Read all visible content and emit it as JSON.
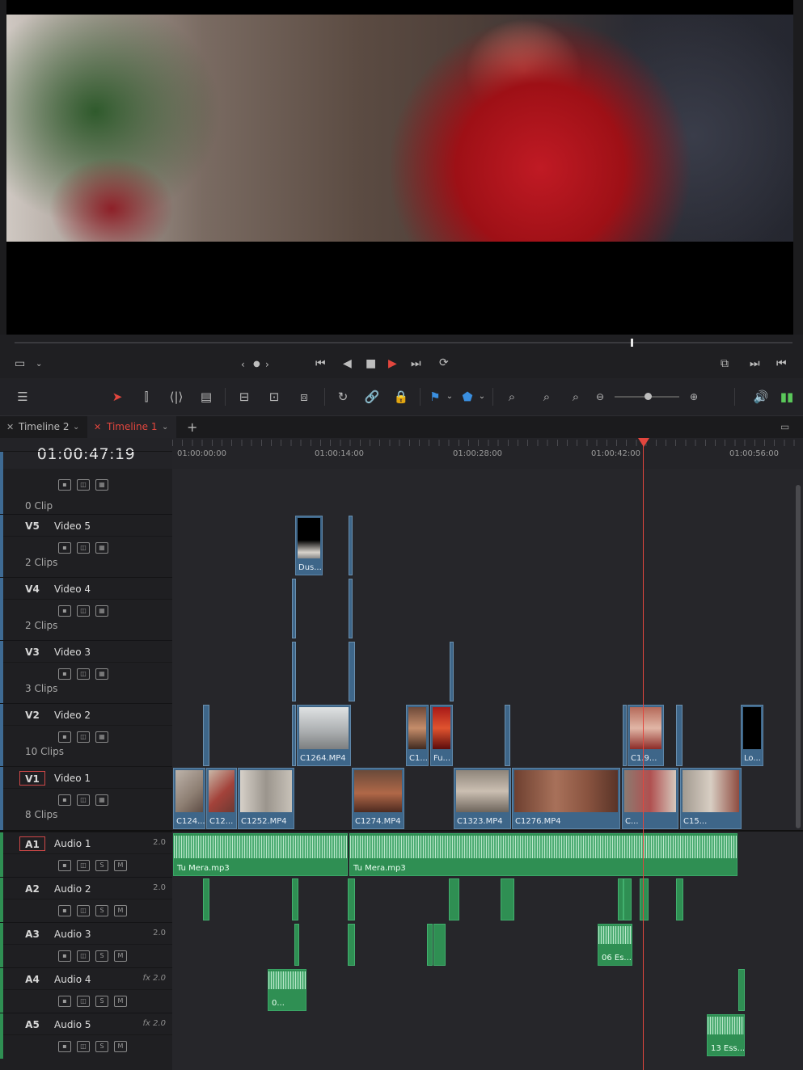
{
  "timecode": "01:00:47:19",
  "tabs": [
    {
      "label": "Timeline 2",
      "active": false
    },
    {
      "label": "Timeline 1",
      "active": true
    }
  ],
  "ruler": [
    "01:00:00:00",
    "01:00:14:00",
    "01:00:28:00",
    "01:00:42:00",
    "01:00:56:00"
  ],
  "video_tracks": [
    {
      "id": "",
      "name": "",
      "count": "0 Clip"
    },
    {
      "id": "V5",
      "name": "Video 5",
      "count": "2 Clips"
    },
    {
      "id": "V4",
      "name": "Video 4",
      "count": "2 Clips"
    },
    {
      "id": "V3",
      "name": "Video 3",
      "count": "3 Clips"
    },
    {
      "id": "V2",
      "name": "Video 2",
      "count": "10 Clips"
    },
    {
      "id": "V1",
      "name": "Video 1",
      "count": "8 Clips"
    }
  ],
  "audio_tracks": [
    {
      "id": "A1",
      "name": "Audio 1",
      "channels": "2.0"
    },
    {
      "id": "A2",
      "name": "Audio 2",
      "channels": "2.0"
    },
    {
      "id": "A3",
      "name": "Audio 3",
      "channels": "2.0"
    },
    {
      "id": "A4",
      "name": "Audio 4",
      "channels": "fx 2.0"
    },
    {
      "id": "A5",
      "name": "Audio 5",
      "channels": "fx 2.0"
    }
  ],
  "clips": {
    "v5": "Dus...",
    "v2": [
      "C1264.MP4",
      "C1...",
      "Fu...",
      "C1.9...",
      "Lo..."
    ],
    "v1": [
      "C124...",
      "C12...",
      "C1252.MP4",
      "C1274.MP4",
      "C1323.MP4",
      "C1276.MP4",
      "C...",
      "C15..."
    ],
    "a1": [
      "Tu Mera.mp3",
      "Tu Mera.mp3"
    ],
    "a3": "06 Es...",
    "a4": "0...",
    "a5": "13 Ess..."
  },
  "colors": {
    "playhead": "#e2463e",
    "video_clip": "#3e6689",
    "audio_clip": "#2f8f53",
    "accent": "#e2463e"
  }
}
